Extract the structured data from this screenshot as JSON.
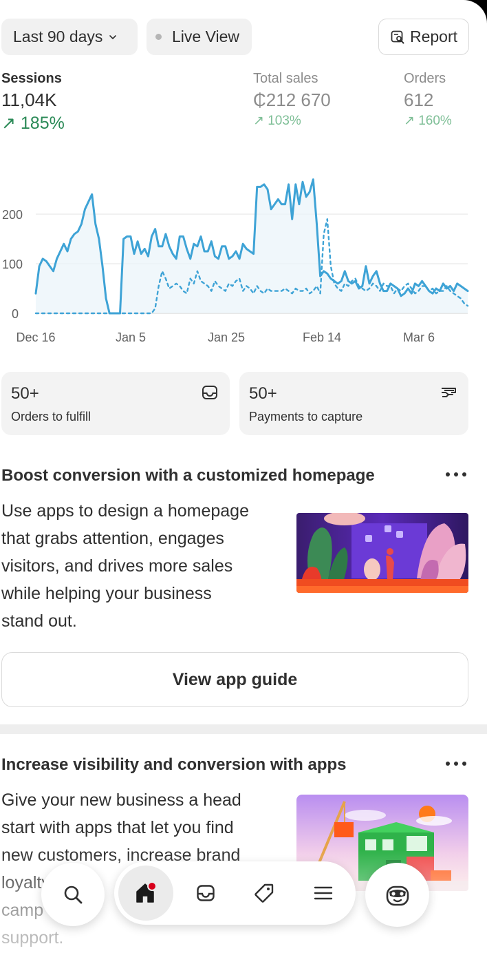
{
  "filters": {
    "range_label": "Last 90 days",
    "live_label": "Live View",
    "report_label": "Report"
  },
  "metrics": {
    "sessions": {
      "label": "Sessions",
      "value": "11,04K",
      "delta": "185%"
    },
    "total_sales": {
      "label": "Total sales",
      "value": "₵212 670",
      "delta": "103%"
    },
    "orders": {
      "label": "Orders",
      "value": "612",
      "delta": "160%"
    }
  },
  "chart_data": {
    "type": "line",
    "x_tick_labels": [
      "Dec 16",
      "Jan 5",
      "Jan 25",
      "Feb 14",
      "Mar 6"
    ],
    "y_tick_labels": [
      "0",
      "100",
      "200"
    ],
    "ylim": [
      0,
      250
    ],
    "grid": true,
    "series": [
      {
        "style": "solid",
        "color": "#3ea3d6",
        "values": [
          40,
          95,
          110,
          105,
          95,
          85,
          110,
          125,
          140,
          125,
          150,
          160,
          165,
          180,
          210,
          225,
          240,
          180,
          150,
          95,
          30,
          0,
          0,
          0,
          0,
          150,
          155,
          155,
          120,
          145,
          120,
          130,
          115,
          155,
          170,
          135,
          135,
          160,
          135,
          120,
          110,
          155,
          155,
          130,
          110,
          140,
          135,
          155,
          125,
          125,
          145,
          115,
          110,
          135,
          135,
          110,
          115,
          125,
          110,
          140,
          130,
          125,
          120,
          255,
          255,
          260,
          250,
          210,
          220,
          230,
          220,
          220,
          260,
          190,
          260,
          220,
          265,
          235,
          245,
          270,
          180,
          75,
          85,
          80,
          70,
          65,
          60,
          65,
          85,
          65,
          60,
          65,
          50,
          55,
          95,
          60,
          75,
          85,
          60,
          45,
          45,
          60,
          55,
          50,
          35,
          40,
          50,
          40,
          60,
          55,
          65,
          55,
          45,
          40,
          50,
          45,
          60,
          50,
          55,
          45,
          60,
          55,
          50,
          45
        ]
      },
      {
        "style": "dashed",
        "color": "#3ea3d6",
        "values": [
          0,
          0,
          0,
          0,
          0,
          0,
          0,
          0,
          0,
          0,
          0,
          0,
          0,
          0,
          0,
          0,
          0,
          0,
          0,
          0,
          0,
          0,
          0,
          0,
          0,
          0,
          0,
          0,
          0,
          0,
          0,
          0,
          0,
          0,
          10,
          55,
          85,
          70,
          50,
          55,
          60,
          55,
          45,
          40,
          70,
          60,
          85,
          65,
          60,
          55,
          45,
          65,
          55,
          50,
          45,
          60,
          55,
          65,
          70,
          45,
          55,
          50,
          40,
          55,
          45,
          40,
          50,
          45,
          45,
          45,
          45,
          50,
          45,
          40,
          50,
          45,
          45,
          50,
          40,
          45,
          55,
          40,
          160,
          190,
          95,
          60,
          50,
          45,
          60,
          55,
          65,
          70,
          55,
          50,
          45,
          50,
          60,
          55,
          45,
          60,
          55,
          55,
          40,
          50,
          45,
          55,
          60,
          50,
          40,
          45,
          55,
          55,
          45,
          50,
          40,
          45,
          45,
          55,
          45,
          40,
          35,
          30,
          20,
          15
        ]
      }
    ]
  },
  "cards": [
    {
      "count": "50+",
      "label": "Orders to fulfill",
      "icon": "inbox-icon"
    },
    {
      "count": "50+",
      "label": "Payments to capture",
      "icon": "cash-icon"
    }
  ],
  "boost": {
    "title": "Boost conversion with a customized homepage",
    "line1": "Use apps to design a homepage",
    "line2": "that grabs attention, engages",
    "line3": "visitors, and drives more sales",
    "line4": "while helping your business",
    "line5": "stand out.",
    "button_label": "View app guide"
  },
  "visibility": {
    "title": "Increase visibility and conversion with apps",
    "line1": "Give your new business a head",
    "line2": "start with apps that let you find",
    "line3": "new customers, increase brand",
    "line4": "loyalty",
    "line5": "camp",
    "line6": "support."
  },
  "nav": {
    "items": [
      "search-icon",
      "home-icon",
      "inbox-icon",
      "tag-icon",
      "menu-icon",
      "avatar-icon"
    ],
    "home_badge_color": "#d8001b"
  }
}
